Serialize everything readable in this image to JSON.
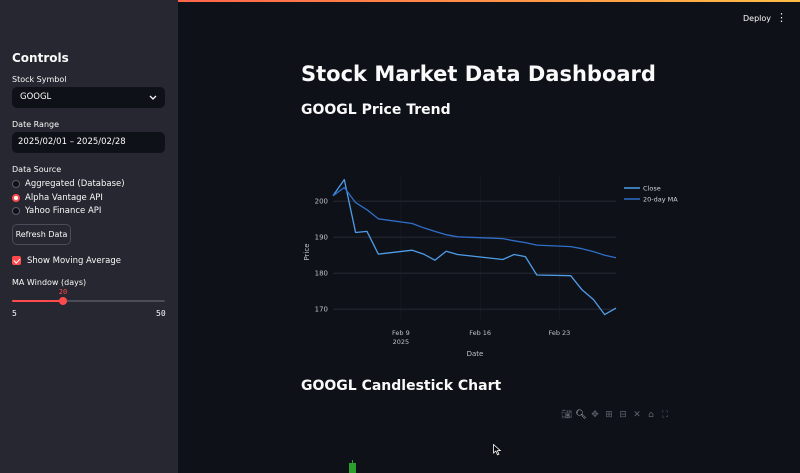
{
  "header": {
    "deploy_label": "Deploy",
    "menu_icon": "vertical-ellipsis-icon"
  },
  "sidebar": {
    "title": "Controls",
    "stock_symbol": {
      "label": "Stock Symbol",
      "value": "GOOGL"
    },
    "date_range": {
      "label": "Date Range",
      "value": "2025/02/01 – 2025/02/28"
    },
    "data_source": {
      "label": "Data Source",
      "options": [
        "Aggregated (Database)",
        "Alpha Vantage API",
        "Yahoo Finance API"
      ],
      "selected_index": 1
    },
    "refresh_label": "Refresh Data",
    "show_ma": {
      "label": "Show Moving Average",
      "checked": true
    },
    "ma_window": {
      "label": "MA Window (days)",
      "value": "20",
      "min": "5",
      "max": "50"
    }
  },
  "main": {
    "title": "Stock Market Data Dashboard",
    "price_section_title": "GOOGL Price Trend",
    "candlestick_section_title": "GOOGL Candlestick Chart"
  },
  "colors": {
    "accent": "#ff4b4b",
    "close_line": "#4f9de8",
    "ma_line": "#2f6fc9",
    "background": "#0e1117",
    "sidebar": "#262730"
  },
  "chart_data": {
    "type": "line",
    "xlabel": "Date",
    "ylabel": "Price",
    "x_tick_labels": [
      "Feb 9\n2025",
      "Feb 16",
      "Feb 23"
    ],
    "y_ticks": [
      "170",
      "180",
      "190",
      "200"
    ],
    "ylim": [
      167,
      207
    ],
    "xlim": [
      "2025-02-03",
      "2025-02-28"
    ],
    "grid": true,
    "legend_position": "top-right",
    "series": [
      {
        "name": "Close",
        "x": [
          "2025-02-03",
          "2025-02-04",
          "2025-02-05",
          "2025-02-06",
          "2025-02-07",
          "2025-02-10",
          "2025-02-11",
          "2025-02-12",
          "2025-02-13",
          "2025-02-14",
          "2025-02-18",
          "2025-02-19",
          "2025-02-20",
          "2025-02-21",
          "2025-02-24",
          "2025-02-25",
          "2025-02-26",
          "2025-02-27",
          "2025-02-28"
        ],
        "values": [
          201.5,
          206.0,
          191.3,
          191.6,
          185.3,
          186.4,
          185.3,
          183.6,
          186.1,
          185.2,
          183.8,
          185.2,
          184.6,
          179.5,
          179.3,
          175.4,
          172.7,
          168.5,
          170.3
        ]
      },
      {
        "name": "20-day MA",
        "x": [
          "2025-02-03",
          "2025-02-04",
          "2025-02-05",
          "2025-02-06",
          "2025-02-07",
          "2025-02-10",
          "2025-02-11",
          "2025-02-12",
          "2025-02-13",
          "2025-02-14",
          "2025-02-18",
          "2025-02-19",
          "2025-02-20",
          "2025-02-21",
          "2025-02-24",
          "2025-02-25",
          "2025-02-26",
          "2025-02-27",
          "2025-02-28"
        ],
        "values": [
          201.5,
          203.8,
          199.6,
          197.6,
          195.1,
          193.8,
          192.6,
          191.6,
          190.7,
          190.1,
          189.6,
          189.0,
          188.5,
          187.8,
          187.4,
          186.8,
          186.0,
          185.0,
          184.3
        ]
      }
    ]
  }
}
